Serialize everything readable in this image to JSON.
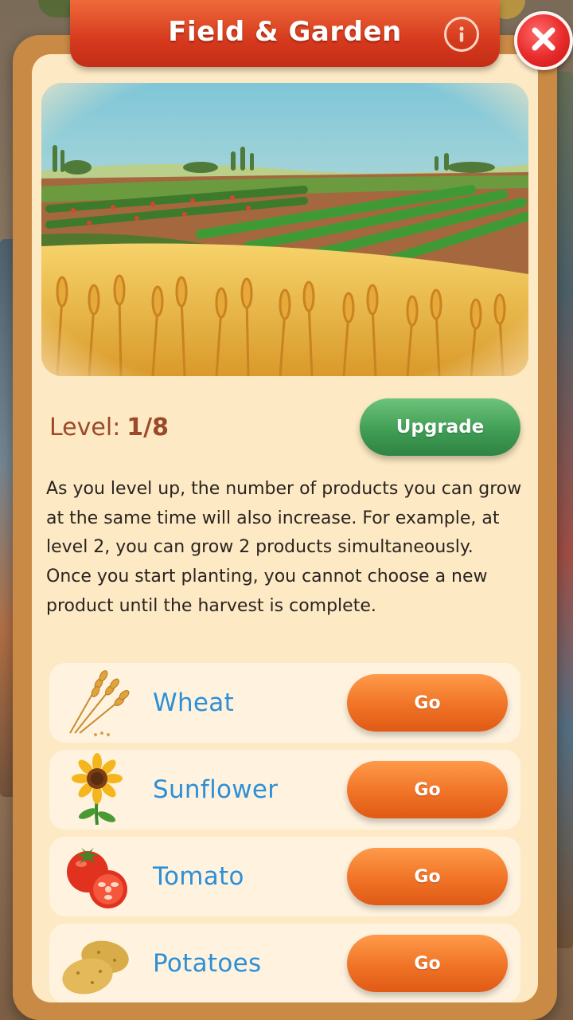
{
  "header": {
    "title": "Field & Garden",
    "info_icon": "info-icon",
    "close_icon": "close-icon"
  },
  "hero": {
    "image": "field-garden-illustration"
  },
  "level": {
    "label": "Level:",
    "value": "1/8"
  },
  "upgrade": {
    "label": "Upgrade"
  },
  "description": {
    "line1": "As you level up, the number of products you can grow at the same time will also increase. For example, at level 2, you can grow 2 products simultaneously.",
    "line2": "Once you start planting, you cannot choose a new product until the harvest is complete."
  },
  "products": [
    {
      "name": "Wheat",
      "button": "Go",
      "icon": "wheat-icon"
    },
    {
      "name": "Sunflower",
      "button": "Go",
      "icon": "sunflower-icon"
    },
    {
      "name": "Tomato",
      "button": "Go",
      "icon": "tomato-icon"
    },
    {
      "name": "Potatoes",
      "button": "Go",
      "icon": "potato-icon"
    }
  ],
  "colors": {
    "header": "#d63a1e",
    "panel": "#fde9c4",
    "frame": "#c98a46",
    "upgrade_button": "#3e9a52",
    "go_button": "#f07326",
    "product_label": "#2d8fd6",
    "level_text": "#9a4a2a"
  }
}
